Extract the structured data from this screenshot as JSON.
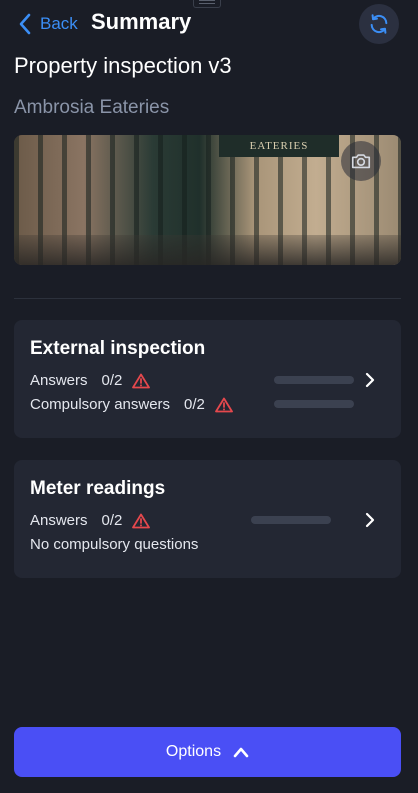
{
  "header": {
    "back_label": "Back",
    "title": "Summary",
    "refresh_icon": "refresh-icon"
  },
  "page": {
    "title": "Property inspection v3",
    "subtitle": "Ambrosia Eateries"
  },
  "photo": {
    "sign_text": "EATERIES",
    "camera_icon": "camera-icon"
  },
  "sections": [
    {
      "title": "External inspection",
      "answers_label": "Answers",
      "answers_count": "0/2",
      "answers_progress": 0,
      "compulsory_label": "Compulsory answers",
      "compulsory_count": "0/2",
      "compulsory_progress": 0
    },
    {
      "title": "Meter readings",
      "answers_label": "Answers",
      "answers_count": "0/2",
      "answers_progress": 0,
      "note": "No compulsory questions"
    }
  ],
  "footer": {
    "options_label": "Options"
  },
  "colors": {
    "accent": "#3b8ef5",
    "primary_button": "#4a4ff5",
    "warning": "#e5484d",
    "background": "#1a1d26",
    "card": "#232733"
  }
}
